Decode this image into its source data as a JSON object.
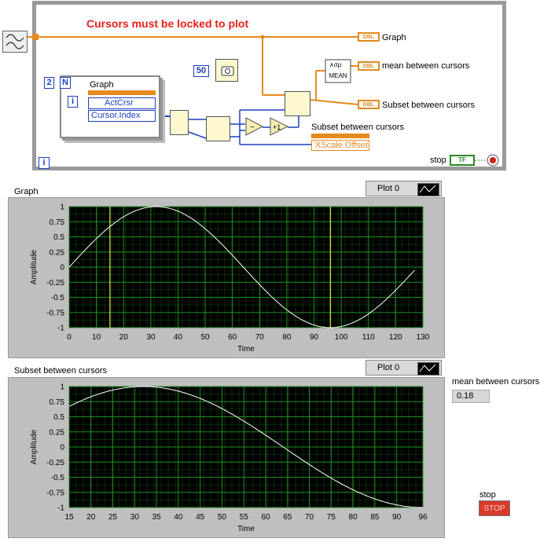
{
  "diagram": {
    "note": "Cursors must be locked to plot",
    "graph_label": "Graph",
    "mean_label": "mean between cursors",
    "subset_label": "Subset between cursors",
    "subset_node_label": "Subset between cursors",
    "loop_count": "2",
    "loop_n": "N",
    "loop_i": "i",
    "outer_i": "i",
    "graph_node_title": "Graph",
    "graph_node_prop1": "ActCrsr",
    "graph_node_prop2": "Cursor.Index",
    "wait_const": "50",
    "mean_text": "MEAN",
    "xscale_prop": "XScale.Offset",
    "stop_label": "stop",
    "tf": "TF",
    "dbl": "DBL"
  },
  "graph": {
    "title": "Graph",
    "legend": "Plot 0",
    "xlabel": "Time",
    "ylabel": "Amplitude",
    "xticks": [
      "0",
      "10",
      "20",
      "30",
      "40",
      "50",
      "60",
      "70",
      "80",
      "90",
      "100",
      "110",
      "120",
      "130"
    ],
    "yticks": [
      "1",
      "0.75",
      "0.5",
      "0.25",
      "0",
      "-0.25",
      "-0.5",
      "-0.75",
      "-1"
    ],
    "cursor_positions": [
      15,
      96
    ]
  },
  "subset": {
    "title": "Subset between cursors",
    "legend": "Plot 0",
    "xlabel": "Time",
    "ylabel": "Amplitude",
    "xticks": [
      "15",
      "20",
      "25",
      "30",
      "35",
      "40",
      "45",
      "50",
      "55",
      "60",
      "65",
      "70",
      "75",
      "80",
      "85",
      "90",
      "96"
    ],
    "yticks": [
      "1",
      "0.75",
      "0.5",
      "0.25",
      "0",
      "-0.25",
      "-0.5",
      "-0.75",
      "-1"
    ]
  },
  "mean": {
    "label": "mean between cursors",
    "value": "0.18"
  },
  "stop": {
    "label": "stop",
    "button": "STOP"
  },
  "colors": {
    "plot_bg": "#000000",
    "grid": "#1f8f1f",
    "trace": "#ffffff",
    "cursor": "#e8e84a",
    "wire_orange": "#e58a1e",
    "wire_blue": "#1d3fbf"
  },
  "chart_data": [
    {
      "type": "line",
      "title": "Graph",
      "xlabel": "Time",
      "ylabel": "Amplitude",
      "xlim": [
        0,
        130
      ],
      "ylim": [
        -1,
        1
      ],
      "grid": true,
      "series": [
        {
          "name": "Plot 0",
          "function": "sin(2*pi*x/128)",
          "x_range": [
            0,
            127
          ]
        }
      ],
      "cursors": [
        15,
        96
      ]
    },
    {
      "type": "line",
      "title": "Subset between cursors",
      "xlabel": "Time",
      "ylabel": "Amplitude",
      "xlim": [
        15,
        96
      ],
      "ylim": [
        -1,
        1
      ],
      "grid": true,
      "series": [
        {
          "name": "Plot 0",
          "function": "sin(2*pi*x/128)",
          "x_range": [
            15,
            96
          ]
        }
      ]
    }
  ]
}
